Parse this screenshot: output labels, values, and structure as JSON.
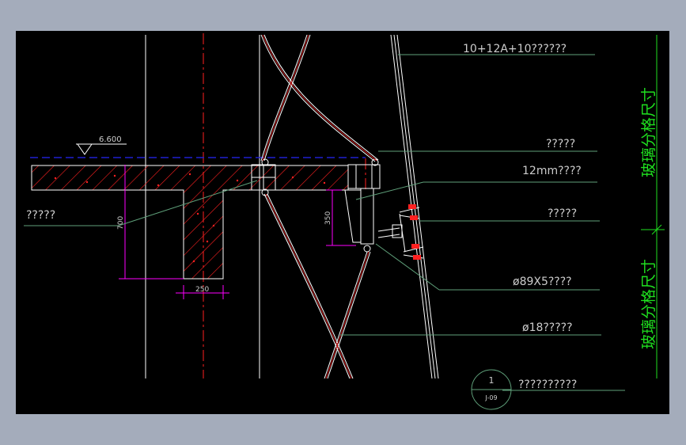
{
  "elevation": {
    "value": "6.600"
  },
  "labels": {
    "glass_spec": "10+12A+10??????",
    "node_a": "?????",
    "steel_plate": "12mm????",
    "node_b": "?????",
    "left_callout": "?????",
    "tube": "ø89X5????",
    "rod": "ø18?????",
    "detail_note": "??????????"
  },
  "dimensions": {
    "beam_depth": "700",
    "beam_width": "250",
    "bracket_height": "350"
  },
  "side_labels": {
    "upper": "玻璃分格尺寸",
    "lower": "玻璃分格尺寸"
  },
  "detail_tag": {
    "number": "1",
    "sheet": "J-09"
  },
  "colors": {
    "background": "#000000",
    "outer": "#a4acbb",
    "structure_line": "#ffffff",
    "axis": "#ff2020",
    "dimension": "#ff00ff",
    "leader": "#5fa07a",
    "text": "#cccccc",
    "side_text": "#1fe01f",
    "level_line": "#2020d0",
    "hatch": "#ff2020"
  }
}
